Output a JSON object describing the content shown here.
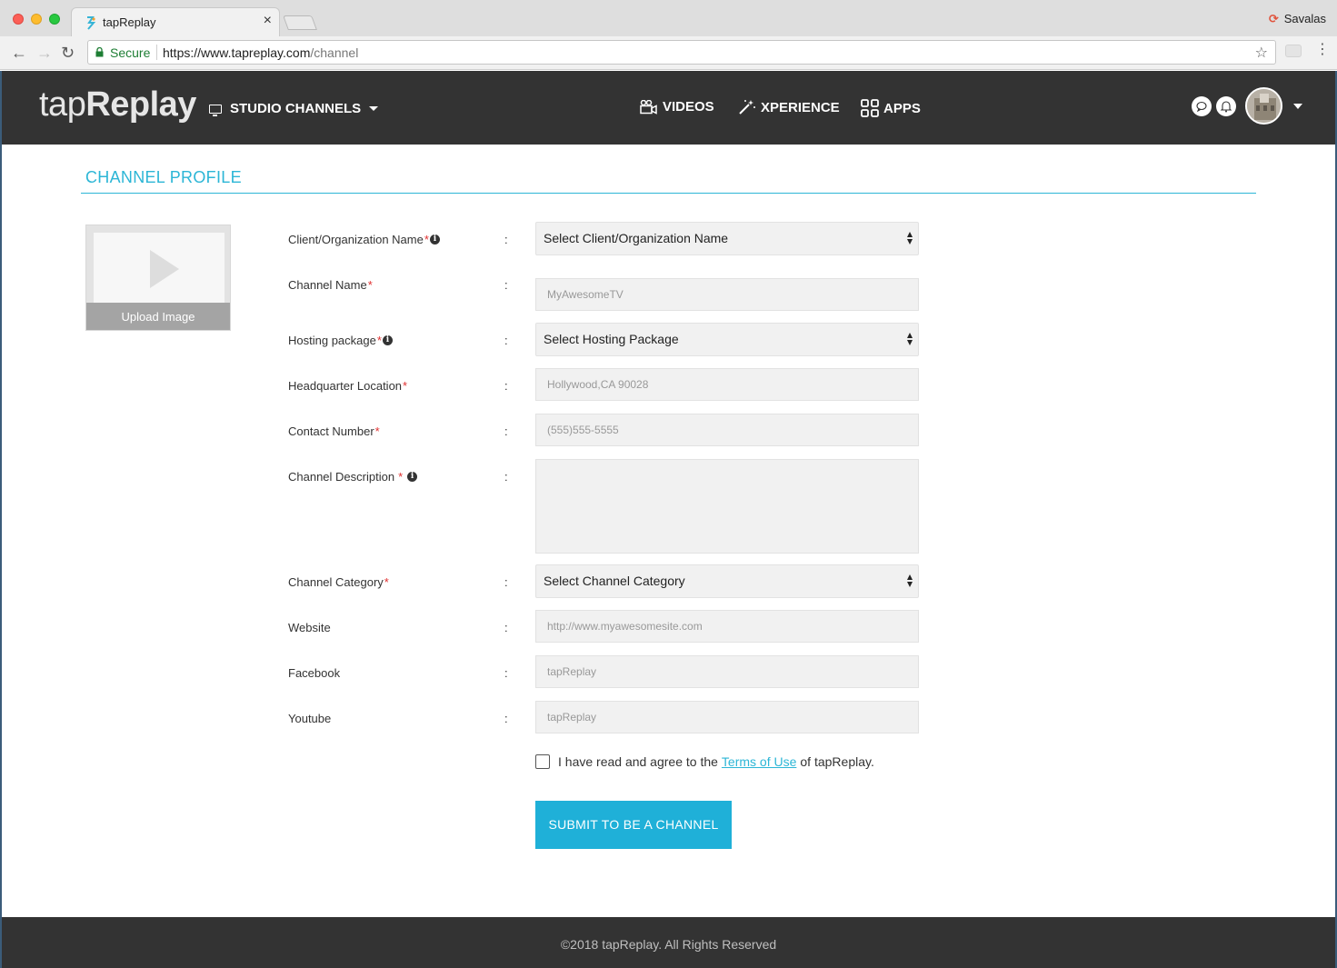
{
  "browser": {
    "tab_title": "tapReplay",
    "tab_close": "×",
    "profile_name": "Savalas",
    "secure_label": "Secure",
    "url_scheme_host": "https://www.tapreplay.com",
    "url_path": "/channel",
    "back": "←",
    "forward": "→",
    "reload": "↻",
    "star": "☆",
    "menu": "⋮"
  },
  "header": {
    "logo_light": "tap",
    "logo_bold": "Replay",
    "studio_label": "STUDIO CHANNELS",
    "nav": [
      {
        "label": "VIDEOS",
        "icon": "video-camera-icon"
      },
      {
        "label": "XPERIENCE",
        "icon": "magic-wand-icon"
      },
      {
        "label": "APPS",
        "icon": "apps-grid-icon"
      }
    ]
  },
  "page": {
    "title": "CHANNEL PROFILE",
    "upload_label": "Upload Image",
    "colon": ":",
    "required_mark": "*",
    "info_glyph": "i"
  },
  "form": {
    "client_org": {
      "label": "Client/Organization Name",
      "value": "Select Client/Organization Name"
    },
    "channel_name": {
      "label": "Channel Name",
      "placeholder": "MyAwesomeTV"
    },
    "hosting": {
      "label": "Hosting package",
      "value": "Select Hosting Package"
    },
    "hq": {
      "label": "Headquarter Location",
      "placeholder": "Hollywood,CA 90028"
    },
    "contact": {
      "label": "Contact Number",
      "placeholder": "(555)555-5555"
    },
    "description": {
      "label": "Channel Description "
    },
    "category": {
      "label": "Channel Category",
      "value": "Select Channel Category"
    },
    "website": {
      "label": "Website",
      "placeholder": "http://www.myawesomesite.com"
    },
    "facebook": {
      "label": "Facebook",
      "placeholder": "tapReplay"
    },
    "youtube": {
      "label": "Youtube",
      "placeholder": "tapReplay"
    },
    "agree_prefix": "I have read and agree to the",
    "terms_link": "Terms of Use",
    "agree_suffix": "of tapReplay.",
    "submit": "SUBMIT TO BE A CHANNEL"
  },
  "footer": {
    "text": "©2018 tapReplay. All Rights Reserved"
  },
  "colors": {
    "accent": "#2cb6d6",
    "button": "#1fb0d8",
    "header_bg": "#333333",
    "required": "#e03030"
  }
}
